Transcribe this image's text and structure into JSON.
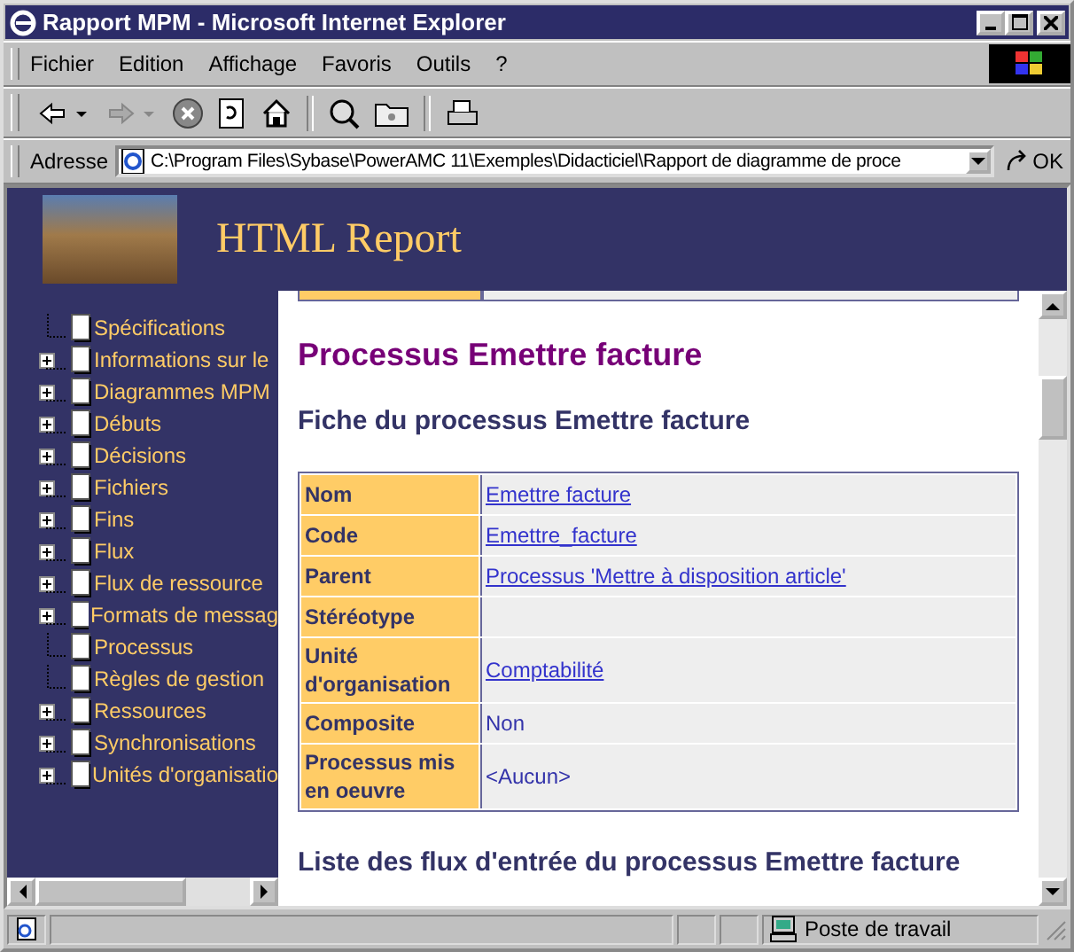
{
  "window": {
    "title": "Rapport MPM - Microsoft Internet Explorer"
  },
  "menu": [
    "Fichier",
    "Edition",
    "Affichage",
    "Favoris",
    "Outils",
    "?"
  ],
  "address": {
    "label": "Adresse",
    "value": "C:\\Program Files\\Sybase\\PowerAMC 11\\Exemples\\Didacticiel\\Rapport de diagramme de proce",
    "go": "OK"
  },
  "banner": {
    "title": "HTML Report"
  },
  "tree": [
    {
      "label": "Spécifications",
      "kind": "leaf"
    },
    {
      "label": "Informations sur le",
      "kind": "collapsed"
    },
    {
      "label": "Diagrammes MPM",
      "kind": "collapsed"
    },
    {
      "label": "Débuts",
      "kind": "collapsed"
    },
    {
      "label": "Décisions",
      "kind": "collapsed"
    },
    {
      "label": "Fichiers",
      "kind": "collapsed"
    },
    {
      "label": "Fins",
      "kind": "collapsed"
    },
    {
      "label": "Flux",
      "kind": "collapsed"
    },
    {
      "label": "Flux de ressource",
      "kind": "collapsed"
    },
    {
      "label": "Formats de messag",
      "kind": "collapsed"
    },
    {
      "label": "Processus",
      "kind": "leaf"
    },
    {
      "label": "Règles de gestion",
      "kind": "leaf"
    },
    {
      "label": "Ressources",
      "kind": "collapsed"
    },
    {
      "label": "Synchronisations",
      "kind": "collapsed"
    },
    {
      "label": "Unités d'organisatio",
      "kind": "collapsed"
    }
  ],
  "page": {
    "title": "Processus Emettre facture",
    "section": "Fiche du processus Emettre facture",
    "rows": [
      {
        "label": "Nom",
        "value": "Emettre facture",
        "link": true
      },
      {
        "label": "Code",
        "value": "Emettre_facture",
        "link": true
      },
      {
        "label": "Parent",
        "value": "Processus 'Mettre à disposition article'",
        "link": true
      },
      {
        "label": "Stéréotype"
      },
      {
        "label": "Unité d'organisation",
        "value": "Comptabilité",
        "link": true
      },
      {
        "label": "Composite",
        "value": "Non",
        "link": false
      },
      {
        "label": "Processus mis en oeuvre",
        "value": "<Aucun>",
        "link": false
      }
    ],
    "next_section": "Liste des flux d'entrée du processus Emettre facture"
  },
  "status_bar": {
    "zone": "Poste de travail"
  }
}
